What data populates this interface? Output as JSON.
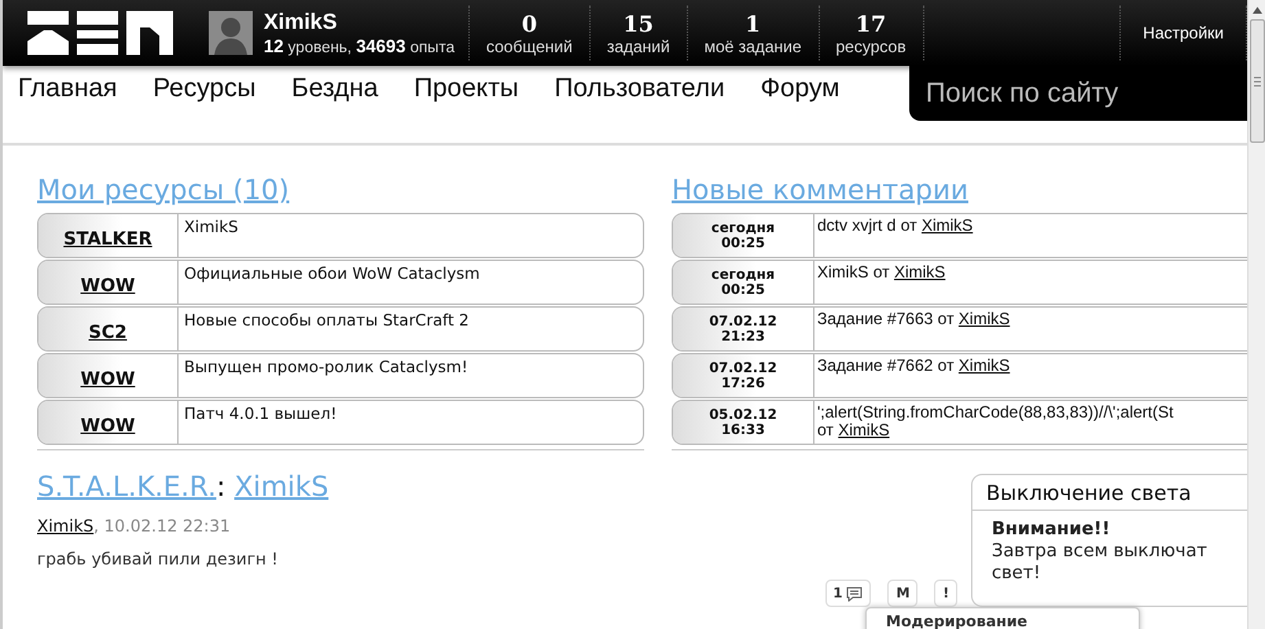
{
  "header": {
    "user": {
      "name": "XimikS",
      "level": "12",
      "level_label": "уровень,",
      "xp": "34693",
      "xp_label": "опыта"
    },
    "stats": [
      {
        "value": "0",
        "label": "сообщений"
      },
      {
        "value": "15",
        "label": "заданий"
      },
      {
        "value": "1",
        "label": "моё задание"
      },
      {
        "value": "17",
        "label": "ресурсов"
      }
    ],
    "settings": "Настройки"
  },
  "nav": {
    "items": [
      "Главная",
      "Ресурсы",
      "Бездна",
      "Проекты",
      "Пользователи",
      "Форум"
    ],
    "search": {
      "placeholder": "Поиск по сайту"
    }
  },
  "resources": {
    "title": "Мои ресурсы (10)",
    "rows": [
      {
        "tag": "STALKER",
        "title": "XimikS"
      },
      {
        "tag": "WOW",
        "title": "Официальные обои WoW Cataclysm"
      },
      {
        "tag": "SC2",
        "title": "Новые способы оплаты StarCraft 2"
      },
      {
        "tag": "WOW",
        "title": "Выпущен промо-ролик Cataclysm!"
      },
      {
        "tag": "WOW",
        "title": "Патч 4.0.1 вышел!"
      }
    ]
  },
  "comments": {
    "title": "Новые комментарии",
    "rows": [
      {
        "date": "сегодня",
        "time": "00:25",
        "text": "dctv xvjrt d",
        "by": "от",
        "author": "XimikS"
      },
      {
        "date": "сегодня",
        "time": "00:25",
        "text": "XimikS",
        "by": "от",
        "author": "XimikS"
      },
      {
        "date": "07.02.12",
        "time": "21:23",
        "text": "Задание #7663",
        "by": "от",
        "author": "XimikS"
      },
      {
        "date": "07.02.12",
        "time": "17:26",
        "text": "Задание #7662",
        "by": "от",
        "author": "XimikS"
      },
      {
        "date": "05.02.12",
        "time": "16:33",
        "text": "';alert(String.fromCharCode(88,83,83))//\\';alert(St",
        "by": "от",
        "author": "XimikS"
      }
    ]
  },
  "post": {
    "category": "S.T.A.L.K.E.R.",
    "separator": ":",
    "title": "XimikS",
    "author": "XimikS",
    "date": ", 10.02.12 22:31",
    "text": "грабь убивай пили дезигн !",
    "actions": [
      {
        "kind": "comments",
        "label": "1"
      },
      {
        "kind": "moderate",
        "label": "M"
      },
      {
        "kind": "report",
        "label": "!"
      }
    ],
    "menu": {
      "title": "Модерирование"
    }
  },
  "notice": {
    "title": "Выключение света",
    "heading": "Внимание!!",
    "text": "Завтра всем выключат свет!"
  }
}
